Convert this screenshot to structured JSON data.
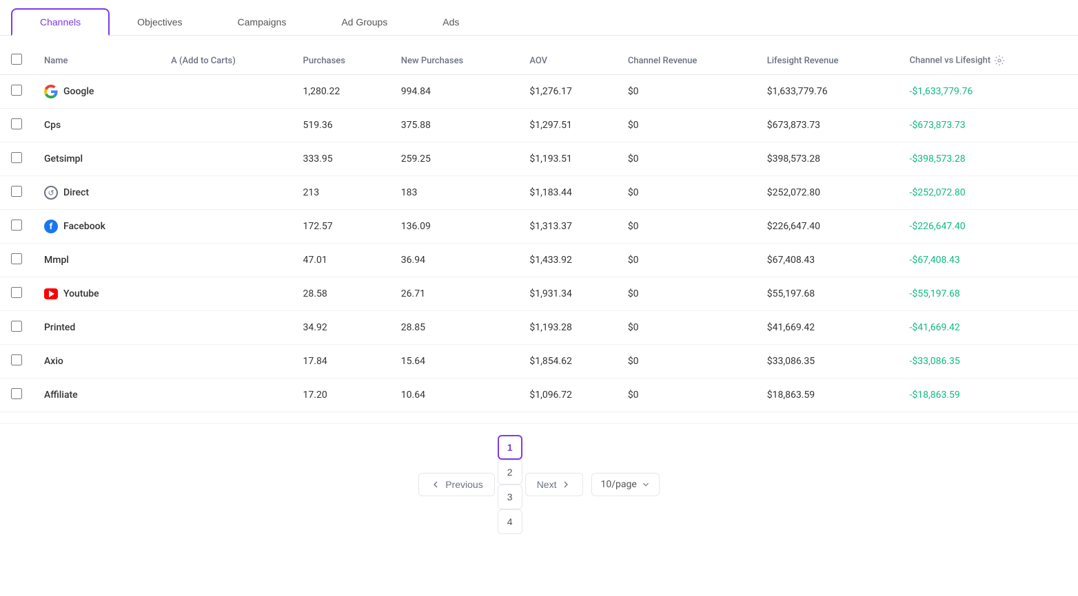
{
  "tabs": [
    {
      "label": "Channels",
      "active": true
    },
    {
      "label": "Objectives",
      "active": false
    },
    {
      "label": "Campaigns",
      "active": false
    },
    {
      "label": "Ad Groups",
      "active": false
    },
    {
      "label": "Ads",
      "active": false
    }
  ],
  "table": {
    "columns": [
      {
        "id": "checkbox",
        "label": ""
      },
      {
        "id": "name",
        "label": "Name"
      },
      {
        "id": "add_to_carts",
        "label": "A (Add to Carts)"
      },
      {
        "id": "purchases",
        "label": "Purchases"
      },
      {
        "id": "new_purchases",
        "label": "New Purchases"
      },
      {
        "id": "aov",
        "label": "AOV"
      },
      {
        "id": "channel_revenue",
        "label": "Channel Revenue"
      },
      {
        "id": "lifesight_revenue",
        "label": "Lifesight Revenue"
      },
      {
        "id": "channel_vs_lifesight",
        "label": "Channel vs Lifesight"
      }
    ],
    "rows": [
      {
        "id": 1,
        "name": "Google",
        "icon": "google",
        "add_to_carts": "",
        "purchases": "1,280.22",
        "new_purchases": "994.84",
        "aov": "$1,276.17",
        "channel_revenue": "$0",
        "lifesight_revenue": "$1,633,779.76",
        "channel_vs_lifesight": "-$1,633,779.76"
      },
      {
        "id": 2,
        "name": "Cps",
        "icon": "none",
        "add_to_carts": "",
        "purchases": "519.36",
        "new_purchases": "375.88",
        "aov": "$1,297.51",
        "channel_revenue": "$0",
        "lifesight_revenue": "$673,873.73",
        "channel_vs_lifesight": "-$673,873.73"
      },
      {
        "id": 3,
        "name": "Getsimpl",
        "icon": "none",
        "add_to_carts": "",
        "purchases": "333.95",
        "new_purchases": "259.25",
        "aov": "$1,193.51",
        "channel_revenue": "$0",
        "lifesight_revenue": "$398,573.28",
        "channel_vs_lifesight": "-$398,573.28"
      },
      {
        "id": 4,
        "name": "Direct",
        "icon": "direct",
        "add_to_carts": "",
        "purchases": "213",
        "new_purchases": "183",
        "aov": "$1,183.44",
        "channel_revenue": "$0",
        "lifesight_revenue": "$252,072.80",
        "channel_vs_lifesight": "-$252,072.80"
      },
      {
        "id": 5,
        "name": "Facebook",
        "icon": "facebook",
        "add_to_carts": "",
        "purchases": "172.57",
        "new_purchases": "136.09",
        "aov": "$1,313.37",
        "channel_revenue": "$0",
        "lifesight_revenue": "$226,647.40",
        "channel_vs_lifesight": "-$226,647.40"
      },
      {
        "id": 6,
        "name": "Mmpl",
        "icon": "none",
        "add_to_carts": "",
        "purchases": "47.01",
        "new_purchases": "36.94",
        "aov": "$1,433.92",
        "channel_revenue": "$0",
        "lifesight_revenue": "$67,408.43",
        "channel_vs_lifesight": "-$67,408.43"
      },
      {
        "id": 7,
        "name": "Youtube",
        "icon": "youtube",
        "add_to_carts": "",
        "purchases": "28.58",
        "new_purchases": "26.71",
        "aov": "$1,931.34",
        "channel_revenue": "$0",
        "lifesight_revenue": "$55,197.68",
        "channel_vs_lifesight": "-$55,197.68"
      },
      {
        "id": 8,
        "name": "Printed",
        "icon": "none",
        "add_to_carts": "",
        "purchases": "34.92",
        "new_purchases": "28.85",
        "aov": "$1,193.28",
        "channel_revenue": "$0",
        "lifesight_revenue": "$41,669.42",
        "channel_vs_lifesight": "-$41,669.42"
      },
      {
        "id": 9,
        "name": "Axio",
        "icon": "none",
        "add_to_carts": "",
        "purchases": "17.84",
        "new_purchases": "15.64",
        "aov": "$1,854.62",
        "channel_revenue": "$0",
        "lifesight_revenue": "$33,086.35",
        "channel_vs_lifesight": "-$33,086.35"
      },
      {
        "id": 10,
        "name": "Affiliate",
        "icon": "none",
        "add_to_carts": "",
        "purchases": "17.20",
        "new_purchases": "10.64",
        "aov": "$1,096.72",
        "channel_revenue": "$0",
        "lifesight_revenue": "$18,863.59",
        "channel_vs_lifesight": "-$18,863.59"
      }
    ]
  },
  "pagination": {
    "prev_label": "Previous",
    "next_label": "Next",
    "pages": [
      "1",
      "2",
      "3",
      "4"
    ],
    "current_page": "1",
    "per_page": "10/page"
  }
}
